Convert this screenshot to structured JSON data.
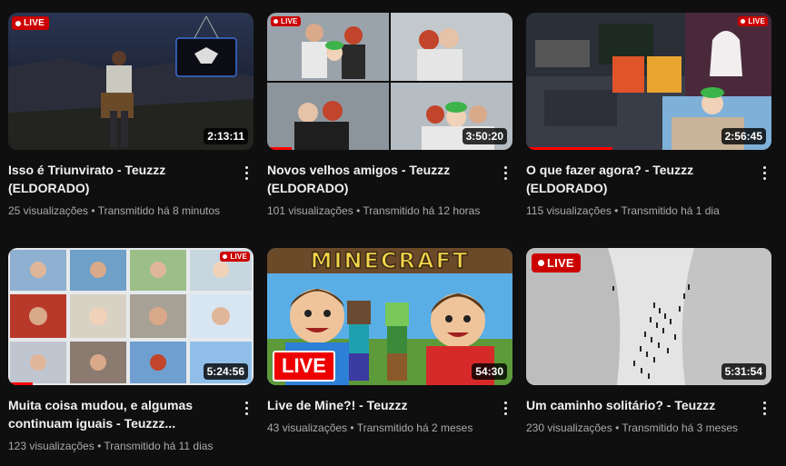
{
  "videos": [
    {
      "title": "Isso é Triunvirato - Teuzzz (ELDORADO)",
      "views": "25 visualizações",
      "streamed": "Transmitido há 8 minutos",
      "duration": "2:13:11",
      "badge": "LIVE",
      "watched": 0
    },
    {
      "title": "Novos velhos amigos - Teuzzz (ELDORADO)",
      "views": "101 visualizações",
      "streamed": "Transmitido há 12 horas",
      "duration": "3:50:20",
      "badge": "LIVE",
      "watched": 0.1
    },
    {
      "title": "O que fazer agora? - Teuzzz (ELDORADO)",
      "views": "115 visualizações",
      "streamed": "Transmitido há 1 dia",
      "duration": "2:56:45",
      "badge": "LIVE",
      "watched": 0.35
    },
    {
      "title": "Muita coisa mudou, e algumas continuam iguais - Teuzzz...",
      "views": "123 visualizações",
      "streamed": "Transmitido há 11 dias",
      "duration": "5:24:56",
      "badge": "LIVE",
      "watched": 0.1
    },
    {
      "title": "Live de Mine?! - Teuzzz",
      "views": "43 visualizações",
      "streamed": "Transmitido há 2 meses",
      "duration": "54:30",
      "badge": "LIVE",
      "overlay_text": "LIVE",
      "logo_text": "MINECRAFT",
      "watched": 0
    },
    {
      "title": "Um caminho solitário? - Teuzzz",
      "views": "230 visualizações",
      "streamed": "Transmitido há 3 meses",
      "duration": "5:31:54",
      "badge": "LIVE",
      "watched": 0
    }
  ],
  "separator": " • ",
  "colors": {
    "live": "#cc0000",
    "progress": "#ff0000",
    "meta": "#aaaaaa"
  }
}
